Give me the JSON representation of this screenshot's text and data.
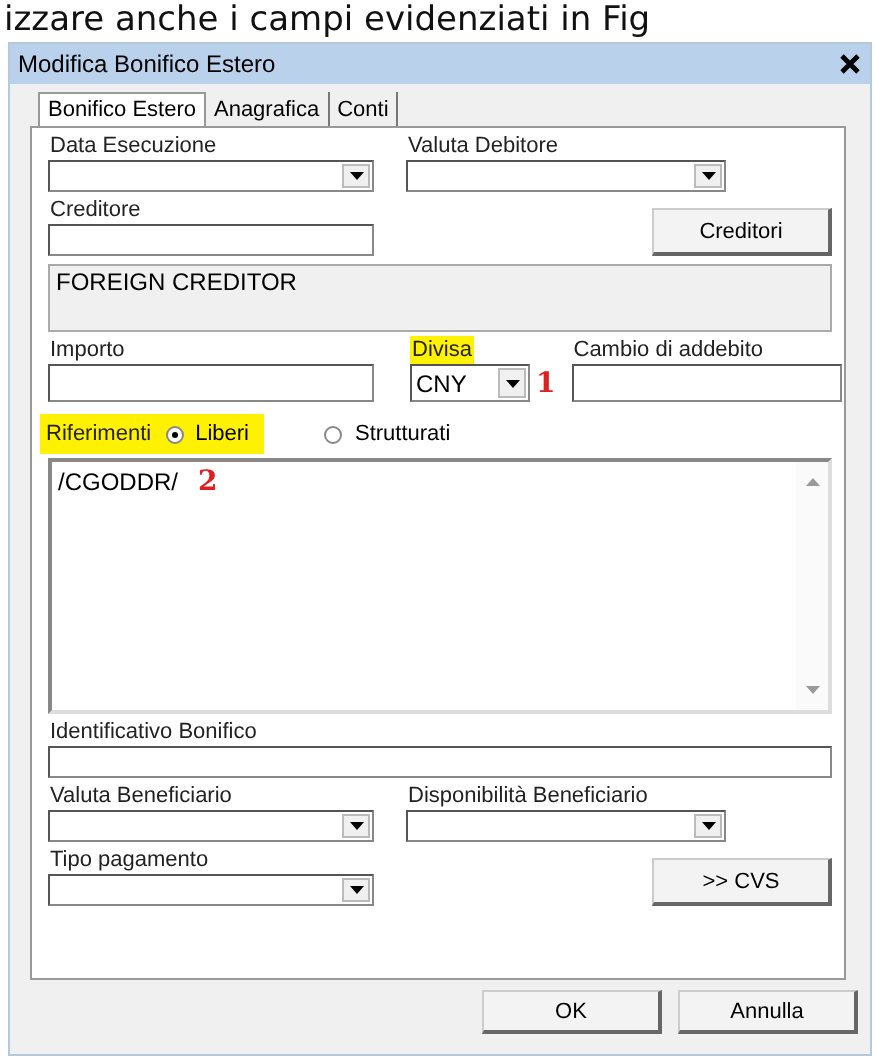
{
  "caption": "izzare anche i campi evidenziati in Fig",
  "window": {
    "title": "Modifica Bonifico Estero"
  },
  "tabs": [
    {
      "label": "Bonifico Estero",
      "selected": true
    },
    {
      "label": "Anagrafica",
      "selected": false
    },
    {
      "label": "Conti",
      "selected": false
    }
  ],
  "data_esecuzione": {
    "label": "Data Esecuzione",
    "highlighted": false
  },
  "valuta_debitore": {
    "label": "Valuta Debitore",
    "highlighted": false
  },
  "creditore": {
    "label": "Creditore",
    "highlighted": false
  },
  "creditori_button": "Creditori",
  "creditor_name": "FOREIGN CREDITOR",
  "importo": {
    "label": "Importo",
    "highlighted": false
  },
  "divisa": {
    "label": "Divisa",
    "highlighted": true,
    "value": "CNY",
    "marker": "1"
  },
  "cambio": {
    "label": "Cambio di addebito",
    "highlighted": false
  },
  "riferimenti": {
    "label": "Riferimenti",
    "highlighted": true,
    "options": [
      {
        "label": "Liberi",
        "selected": true
      },
      {
        "label": "Strutturati",
        "selected": false
      }
    ],
    "text": "/CGODDR/",
    "marker": "2"
  },
  "identificativo": {
    "label": "Identificativo Bonifico",
    "highlighted": false
  },
  "valuta_beneficiario": {
    "label": "Valuta Beneficiario",
    "highlighted": false
  },
  "disponibilita": {
    "label": "Disponibilità Beneficiario",
    "highlighted": false
  },
  "tipo_pagamento": {
    "label": "Tipo pagamento",
    "highlighted": false
  },
  "cvs_button": ">> CVS",
  "buttons": [
    "OK",
    "Annulla"
  ]
}
